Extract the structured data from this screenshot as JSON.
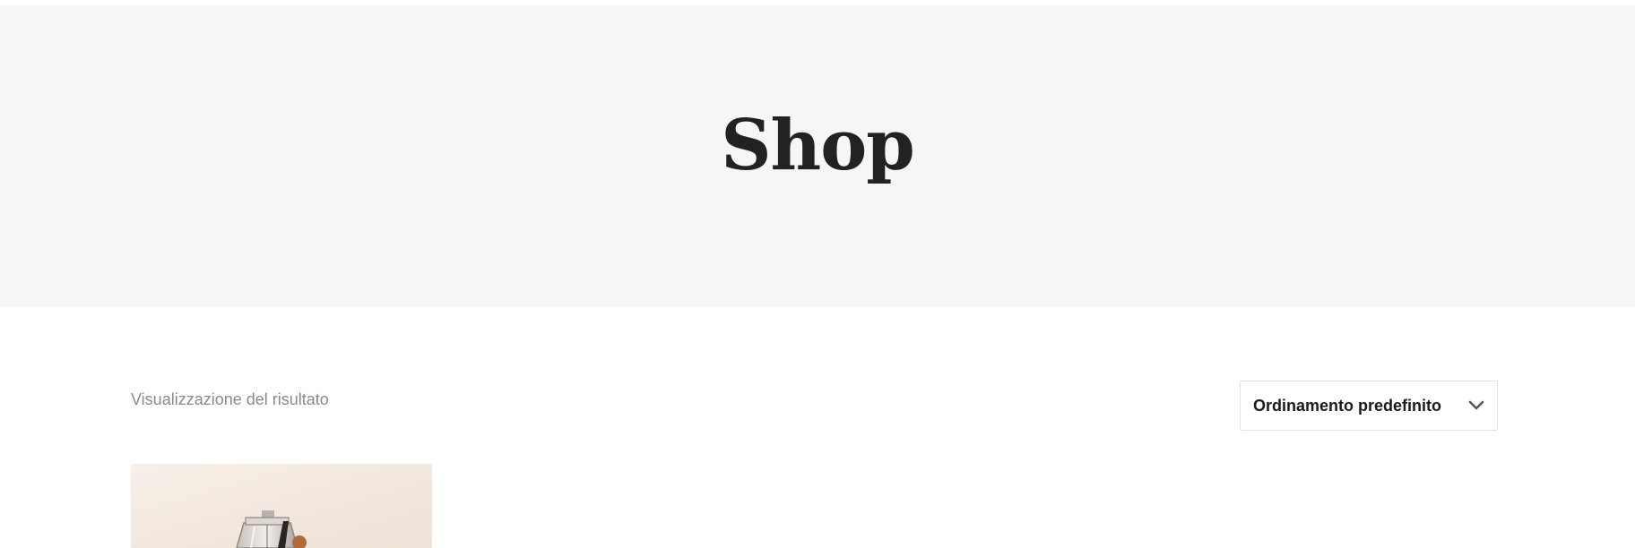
{
  "hero": {
    "title": "Shop"
  },
  "toolbar": {
    "result_count": "Visualizzazione del risultato",
    "sort": {
      "selected": "Ordinamento predefinito",
      "icon": "chevron-down-icon"
    }
  },
  "products": [
    {
      "image_description": "perfume-bottle-image"
    }
  ],
  "colors": {
    "hero_background": "#f6f6f6",
    "title": "#222222",
    "muted_text": "#8a8a8a",
    "border": "#e2e2e2"
  }
}
